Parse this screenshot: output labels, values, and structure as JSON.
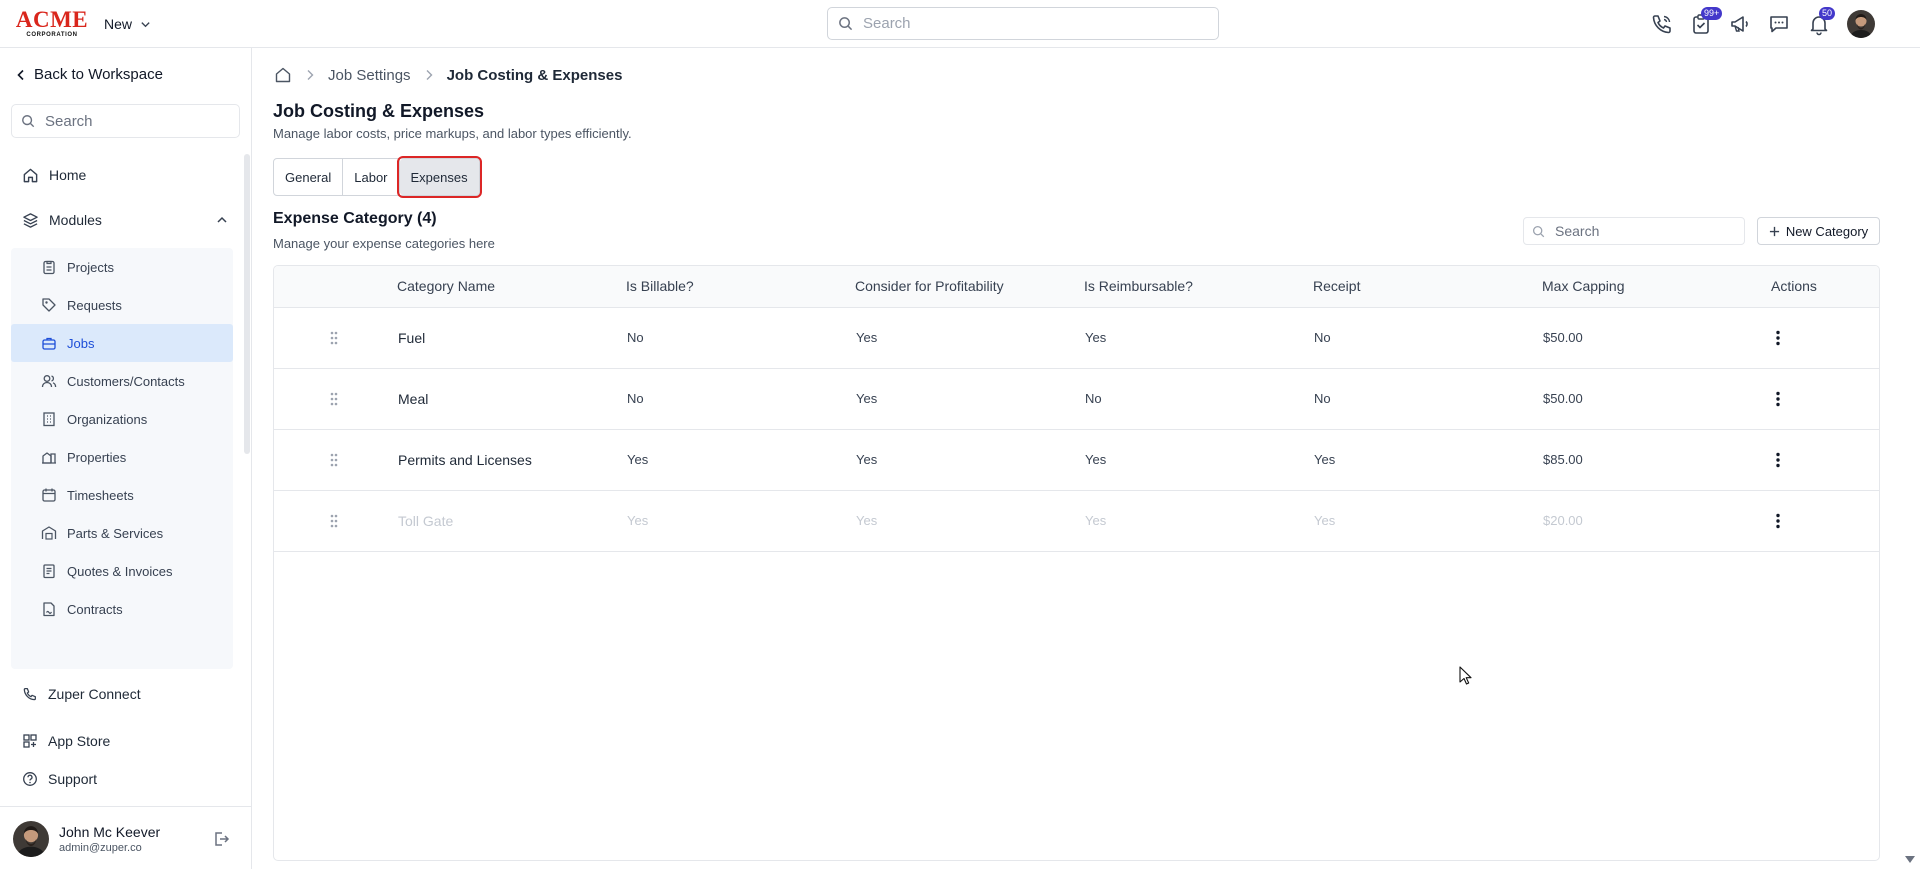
{
  "header": {
    "logo_main": "ACME",
    "logo_sub": "CORPORATION",
    "new_label": "New",
    "search_placeholder": "Search",
    "icons": [
      "phone-icon",
      "tasks-icon",
      "megaphone-icon",
      "chat-icon",
      "bell-icon"
    ],
    "tasks_badge": "99+",
    "notifications_badge": "50"
  },
  "sidebar": {
    "back_label": "Back to Workspace",
    "search_placeholder": "Search",
    "home_label": "Home",
    "modules_label": "Modules",
    "modules": [
      {
        "label": "Projects",
        "icon": "clipboard-icon"
      },
      {
        "label": "Requests",
        "icon": "tag-icon"
      },
      {
        "label": "Jobs",
        "icon": "briefcase-icon",
        "active": true
      },
      {
        "label": "Customers/Contacts",
        "icon": "users-icon"
      },
      {
        "label": "Organizations",
        "icon": "building-icon"
      },
      {
        "label": "Properties",
        "icon": "property-icon"
      },
      {
        "label": "Timesheets",
        "icon": "calendar-icon"
      },
      {
        "label": "Parts & Services",
        "icon": "warehouse-icon"
      },
      {
        "label": "Quotes & Invoices",
        "icon": "invoice-icon"
      },
      {
        "label": "Contracts",
        "icon": "contract-icon"
      }
    ],
    "zuper_connect_label": "Zuper Connect",
    "app_store_label": "App Store",
    "support_label": "Support",
    "user": {
      "name": "John Mc Keever",
      "email": "admin@zuper.co"
    }
  },
  "breadcrumb": {
    "parent": "Job Settings",
    "current": "Job Costing & Expenses"
  },
  "page": {
    "title": "Job Costing & Expenses",
    "subtitle": "Manage labor costs, price markups, and labor types efficiently."
  },
  "tabs": [
    {
      "label": "General",
      "active": false
    },
    {
      "label": "Labor",
      "active": false
    },
    {
      "label": "Expenses",
      "active": true
    }
  ],
  "section": {
    "title": "Expense Category (4)",
    "subtitle": "Manage your expense categories here",
    "search_placeholder": "Search",
    "new_button_label": "New Category"
  },
  "table": {
    "columns": [
      "Category Name",
      "Is Billable?",
      "Consider for Profitability",
      "Is Reimbursable?",
      "Receipt",
      "Max Capping",
      "Actions"
    ],
    "rows": [
      {
        "name": "Fuel",
        "billable": "No",
        "profitability": "Yes",
        "reimbursable": "Yes",
        "receipt": "No",
        "max_capping": "$50.00",
        "disabled": false
      },
      {
        "name": "Meal",
        "billable": "No",
        "profitability": "Yes",
        "reimbursable": "No",
        "receipt": "No",
        "max_capping": "$50.00",
        "disabled": false
      },
      {
        "name": "Permits and Licenses",
        "billable": "Yes",
        "profitability": "Yes",
        "reimbursable": "Yes",
        "receipt": "Yes",
        "max_capping": "$85.00",
        "disabled": false
      },
      {
        "name": "Toll Gate",
        "billable": "Yes",
        "profitability": "Yes",
        "reimbursable": "Yes",
        "receipt": "Yes",
        "max_capping": "$20.00",
        "disabled": true
      }
    ]
  },
  "colors": {
    "logo_red": "#d9261c",
    "active_nav_bg": "#dbe9fb",
    "active_nav_text": "#1d4ed8",
    "badge": "#4338ca",
    "tab_highlight": "#dc2626"
  }
}
